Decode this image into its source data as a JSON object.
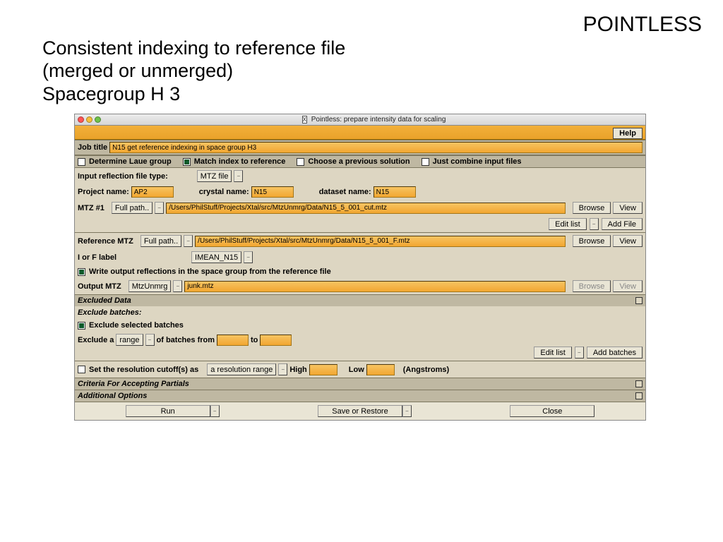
{
  "slide": {
    "title": "POINTLESS",
    "subtitle_l1": "Consistent indexing to reference file",
    "subtitle_l2": "(merged or unmerged)",
    "subtitle_l3": "Spacegroup H 3"
  },
  "win": {
    "title": "Pointless: prepare intensity data for scaling",
    "x_marker": "X",
    "help": "Help"
  },
  "job": {
    "label": "Job title",
    "value": "N15 get reference indexing in space group H3"
  },
  "modes": {
    "laue": "Determine Laue group",
    "match": "Match index to reference",
    "choose": "Choose a previous solution",
    "combine": "Just combine input files"
  },
  "input": {
    "filetype_label": "Input reflection file type:",
    "filetype_sel": "MTZ file",
    "project_label": "Project name:",
    "project_val": "AP2",
    "crystal_label": "crystal name:",
    "crystal_val": "N15",
    "dataset_label": "dataset name:",
    "dataset_val": "N15",
    "mtz1_label": "MTZ #1",
    "fullpath_sel": "Full path..",
    "mtz1_path": "/Users/PhilStuff/Projects/Xtal/src/MtzUnmrg/Data/N15_5_001_cut.mtz",
    "browse": "Browse",
    "view": "View",
    "editlist": "Edit list",
    "addfile": "Add File"
  },
  "ref": {
    "label": "Reference MTZ",
    "fullpath": "Full path..",
    "path": "/Users/PhilStuff/Projects/Xtal/src/MtzUnmrg/Data/N15_5_001_F.mtz",
    "i_or_f": "I or F label",
    "col": "IMEAN_N15",
    "write_sg": "Write output reflections in the space group from the reference file"
  },
  "output": {
    "label": "Output MTZ",
    "base_sel": "MtzUnmrg",
    "file": "junk.mtz"
  },
  "excl": {
    "section": "Excluded Data",
    "batches_h": "Exclude batches:",
    "exclude_selected": "Exclude selected batches",
    "exclude_a": "Exclude a",
    "range": "range",
    "of_batches_from": "of batches from",
    "to": "to",
    "editlist": "Edit list",
    "addbatches": "Add batches"
  },
  "res": {
    "set_cutoff": "Set the resolution cutoff(s) as",
    "range": "a resolution range",
    "high": "High",
    "low": "Low",
    "units": "(Angstroms)"
  },
  "sections": {
    "partials": "Criteria For Accepting Partials",
    "additional": "Additional Options"
  },
  "footer": {
    "run": "Run",
    "save": "Save or Restore",
    "close": "Close"
  }
}
